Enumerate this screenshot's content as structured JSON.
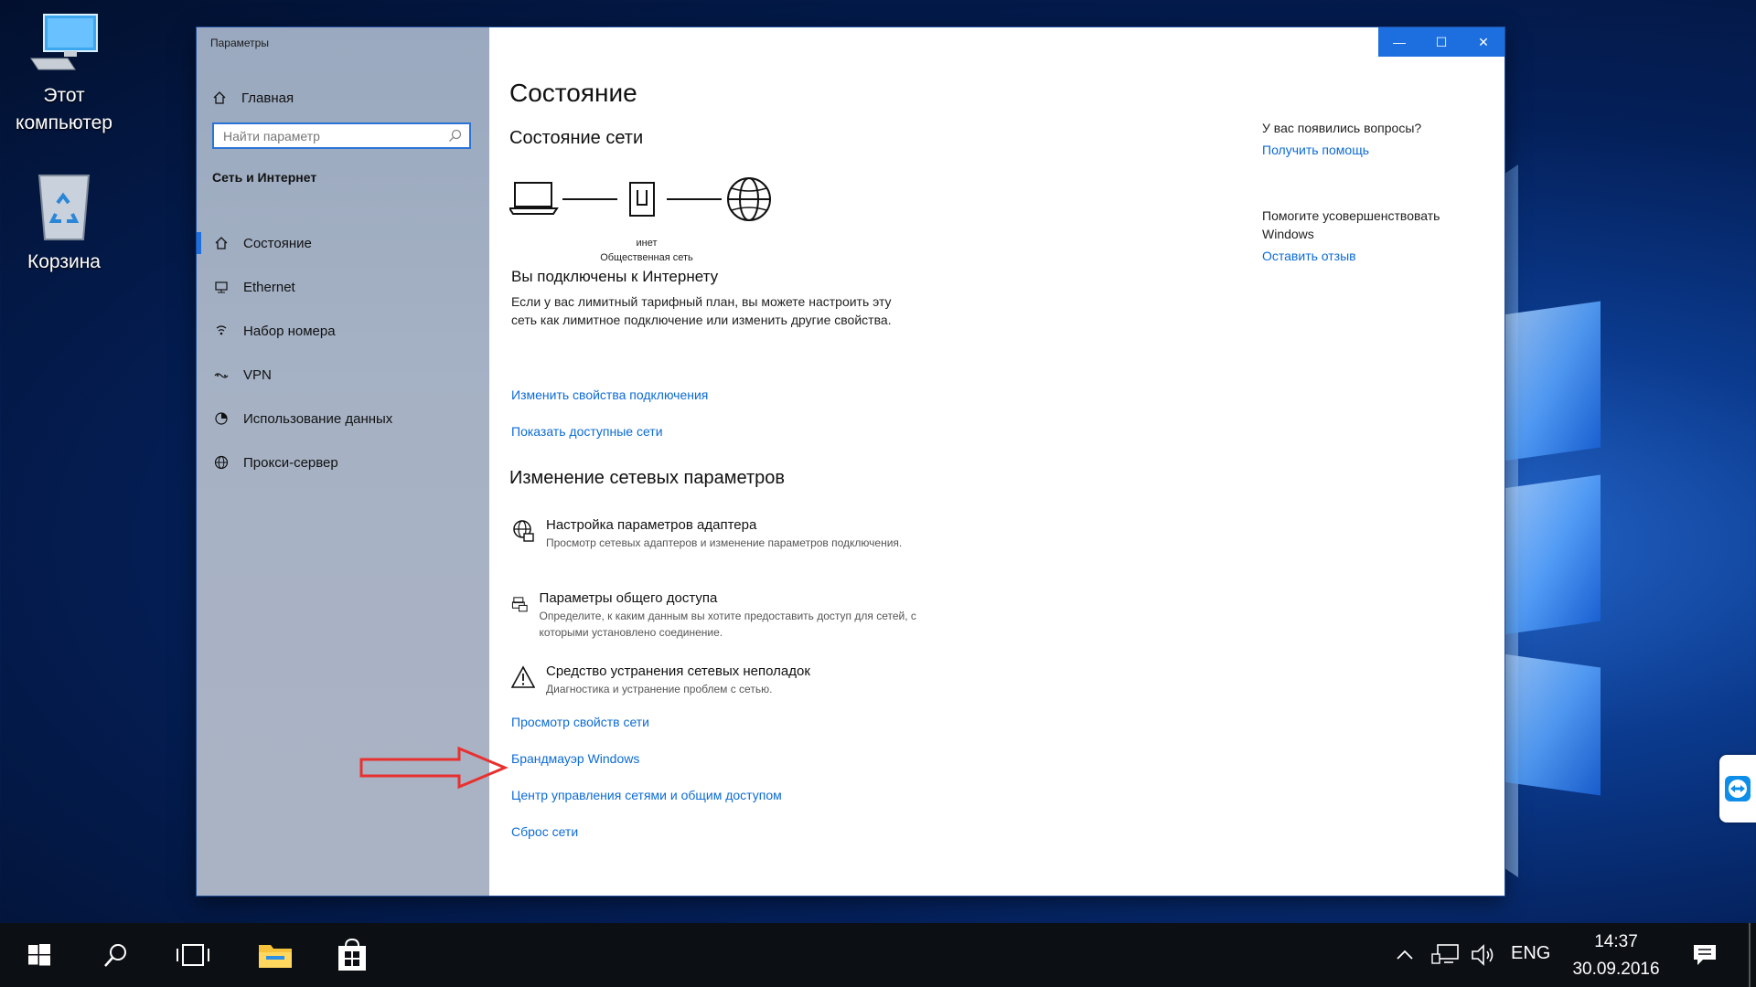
{
  "desktop": {
    "icons": [
      {
        "label_line1": "Этот",
        "label_line2": "компьютер"
      },
      {
        "label_line1": "Корзина",
        "label_line2": ""
      }
    ]
  },
  "window": {
    "title": "Параметры",
    "controls": {
      "minimize": "—",
      "maximize": "☐",
      "close": "✕"
    }
  },
  "sidebar": {
    "home_label": "Главная",
    "search_placeholder": "Найти параметр",
    "section": "Сеть и Интернет",
    "items": [
      {
        "label": "Состояние",
        "icon": "home-network-icon",
        "active": true
      },
      {
        "label": "Ethernet",
        "icon": "ethernet-icon"
      },
      {
        "label": "Набор номера",
        "icon": "dialup-icon"
      },
      {
        "label": "VPN",
        "icon": "vpn-icon"
      },
      {
        "label": "Использование данных",
        "icon": "data-usage-icon"
      },
      {
        "label": "Прокси-сервер",
        "icon": "globe-icon"
      }
    ]
  },
  "main": {
    "title": "Состояние",
    "network_status_heading": "Состояние сети",
    "diagram": {
      "network_name": "инет",
      "network_type": "Общественная сеть"
    },
    "connected_text": "Вы подключены к Интернету",
    "connected_desc": "Если у вас лимитный тарифный план, вы можете настроить эту сеть как лимитное подключение или изменить другие свойства.",
    "links_top": [
      "Изменить свойства подключения",
      "Показать доступные сети"
    ],
    "change_heading": "Изменение сетевых параметров",
    "options": [
      {
        "title": "Настройка параметров адаптера",
        "desc": "Просмотр сетевых адаптеров и изменение параметров подключения."
      },
      {
        "title": "Параметры общего доступа",
        "desc": "Определите, к каким данным вы хотите предоставить доступ для сетей, с которыми установлено соединение."
      },
      {
        "title": "Средство устранения сетевых неполадок",
        "desc": "Диагностика и устранение проблем с сетью."
      }
    ],
    "links_bottom": [
      "Просмотр свойств сети",
      "Брандмауэр Windows",
      "Центр управления сетями и общим доступом",
      "Сброс сети"
    ]
  },
  "help": {
    "question": "У вас появились вопросы?",
    "help_link": "Получить помощь",
    "improve_text": "Помогите усовершенствовать Windows",
    "feedback_link": "Оставить отзыв"
  },
  "taskbar": {
    "language": "ENG",
    "time": "14:37",
    "date": "30.09.2016"
  },
  "colors": {
    "accent": "#1d6fe0",
    "link": "#0c6bd4",
    "arrow": "#e8312f"
  }
}
